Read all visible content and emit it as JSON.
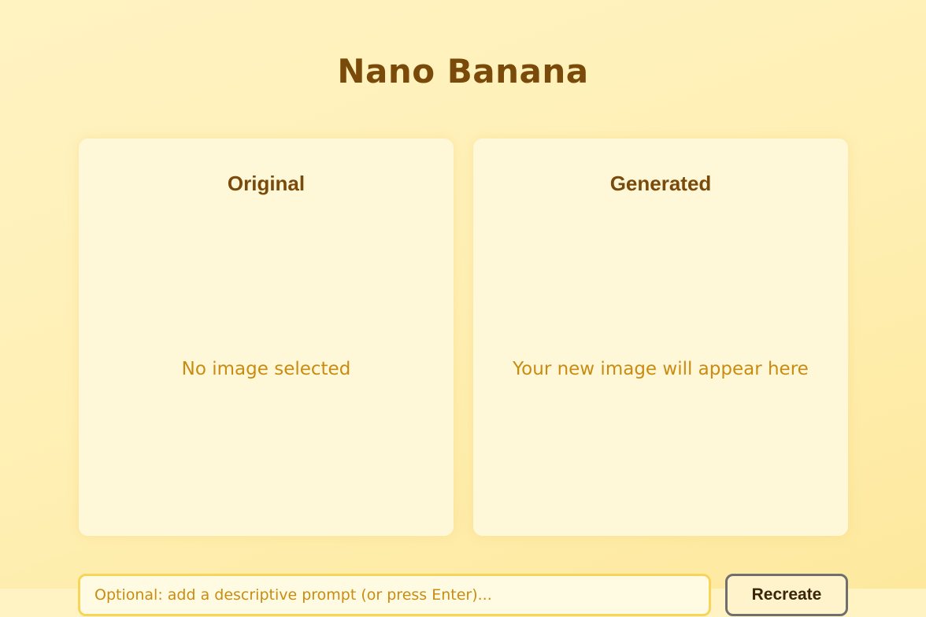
{
  "app": {
    "title": "Nano Banana"
  },
  "panels": {
    "original": {
      "title": "Original",
      "placeholder": "No image selected"
    },
    "generated": {
      "title": "Generated",
      "placeholder": "Your new image will appear here"
    }
  },
  "prompt": {
    "value": "",
    "placeholder": "Optional: add a descriptive prompt (or press Enter)..."
  },
  "actions": {
    "recreate_label": "Recreate"
  },
  "colors": {
    "background": "#fff0b6",
    "panel": "#fff8d8",
    "title": "#7a4a0b",
    "placeholder_text": "#c98c12",
    "input_border": "#f7d45a",
    "button_border": "#6f6f6f"
  }
}
